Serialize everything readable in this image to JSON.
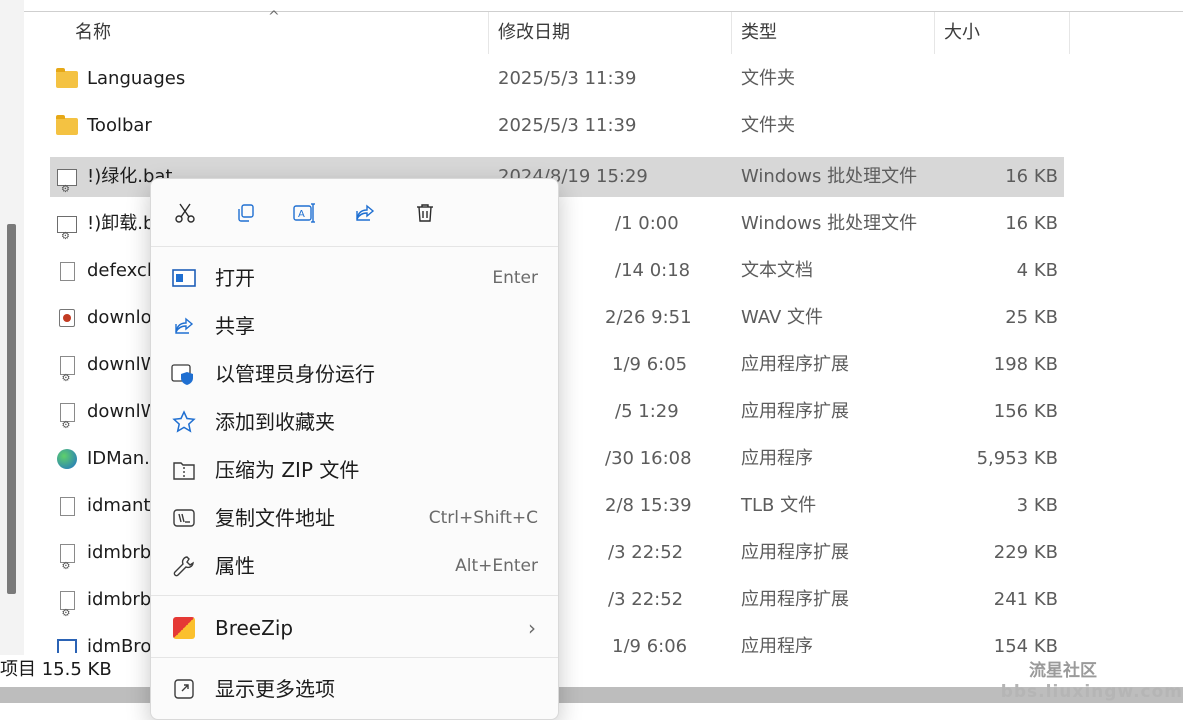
{
  "header": {
    "name": "名称",
    "date": "修改日期",
    "type": "类型",
    "size": "大小",
    "sort_arrow": "^"
  },
  "rows": [
    {
      "icon": "folder-icon",
      "name": "Languages",
      "date": "2025/5/3 11:39",
      "type": "文件夹",
      "size": ""
    },
    {
      "icon": "folder-icon",
      "name": "Toolbar",
      "date": "2025/5/3 11:39",
      "type": "文件夹",
      "size": ""
    },
    {
      "icon": "bat-icon",
      "name": "!)绿化.bat",
      "date": "2024/8/19 15:29",
      "type": "Windows 批处理文件",
      "size": "16 KB",
      "selected": true
    },
    {
      "icon": "bat-icon",
      "name": "!)卸载.b",
      "date": "/1 0:00",
      "type": "Windows 批处理文件",
      "size": "16 KB"
    },
    {
      "icon": "text-file-icon",
      "name": "defexcl",
      "date": "/14 0:18",
      "type": "文本文档",
      "size": "4 KB"
    },
    {
      "icon": "wav-file-icon",
      "name": "downlo",
      "date": "2/26 9:51",
      "type": "WAV 文件",
      "size": "25 KB"
    },
    {
      "icon": "dll-file-icon",
      "name": "downlW",
      "date": "1/9 6:05",
      "type": "应用程序扩展",
      "size": "198 KB"
    },
    {
      "icon": "dll-file-icon",
      "name": "downlW",
      "date": "/5 1:29",
      "type": "应用程序扩展",
      "size": "156 KB"
    },
    {
      "icon": "idm-app-icon",
      "name": "IDMan.",
      "date": "/30 16:08",
      "type": "应用程序",
      "size": "5,953 KB"
    },
    {
      "icon": "text-file-icon",
      "name": "idmant",
      "date": "2/8 15:39",
      "type": "TLB 文件",
      "size": "3 KB"
    },
    {
      "icon": "dll-file-icon",
      "name": "idmbrb",
      "date": "/3 22:52",
      "type": "应用程序扩展",
      "size": "229 KB"
    },
    {
      "icon": "dll-file-icon",
      "name": "idmbrb",
      "date": "/3 22:52",
      "type": "应用程序扩展",
      "size": "241 KB"
    },
    {
      "icon": "app-icon",
      "name": "idmBro",
      "date": "1/9 6:06",
      "type": "应用程序",
      "size": "154 KB"
    }
  ],
  "status": {
    "text": "项目  15.5 KB"
  },
  "watermark": {
    "line1": "流星社区",
    "line2": "bbs.liuxingw.com"
  },
  "context_menu": {
    "quick_actions": [
      {
        "name": "cut-icon",
        "glyph": "✂"
      },
      {
        "name": "copy-icon",
        "glyph": "⧉"
      },
      {
        "name": "rename-icon",
        "glyph": "A"
      },
      {
        "name": "share-icon",
        "glyph": "↗"
      },
      {
        "name": "delete-icon",
        "glyph": "🗑"
      }
    ],
    "items": [
      {
        "label": "打开",
        "accel": "Enter",
        "icon": "open-icon"
      },
      {
        "label": "共享",
        "accel": "",
        "icon": "share-icon"
      },
      {
        "label": "以管理员身份运行",
        "accel": "",
        "icon": "run-as-admin-icon"
      },
      {
        "label": "添加到收藏夹",
        "accel": "",
        "icon": "star-icon"
      },
      {
        "label": "压缩为 ZIP 文件",
        "accel": "",
        "icon": "zip-icon"
      },
      {
        "label": "复制文件地址",
        "accel": "Ctrl+Shift+C",
        "icon": "copy-path-icon"
      },
      {
        "label": "属性",
        "accel": "Alt+Enter",
        "icon": "wrench-icon"
      }
    ],
    "breezip": {
      "label": "BreeZip",
      "chevron": "›"
    },
    "more": {
      "label": "显示更多选项"
    }
  }
}
